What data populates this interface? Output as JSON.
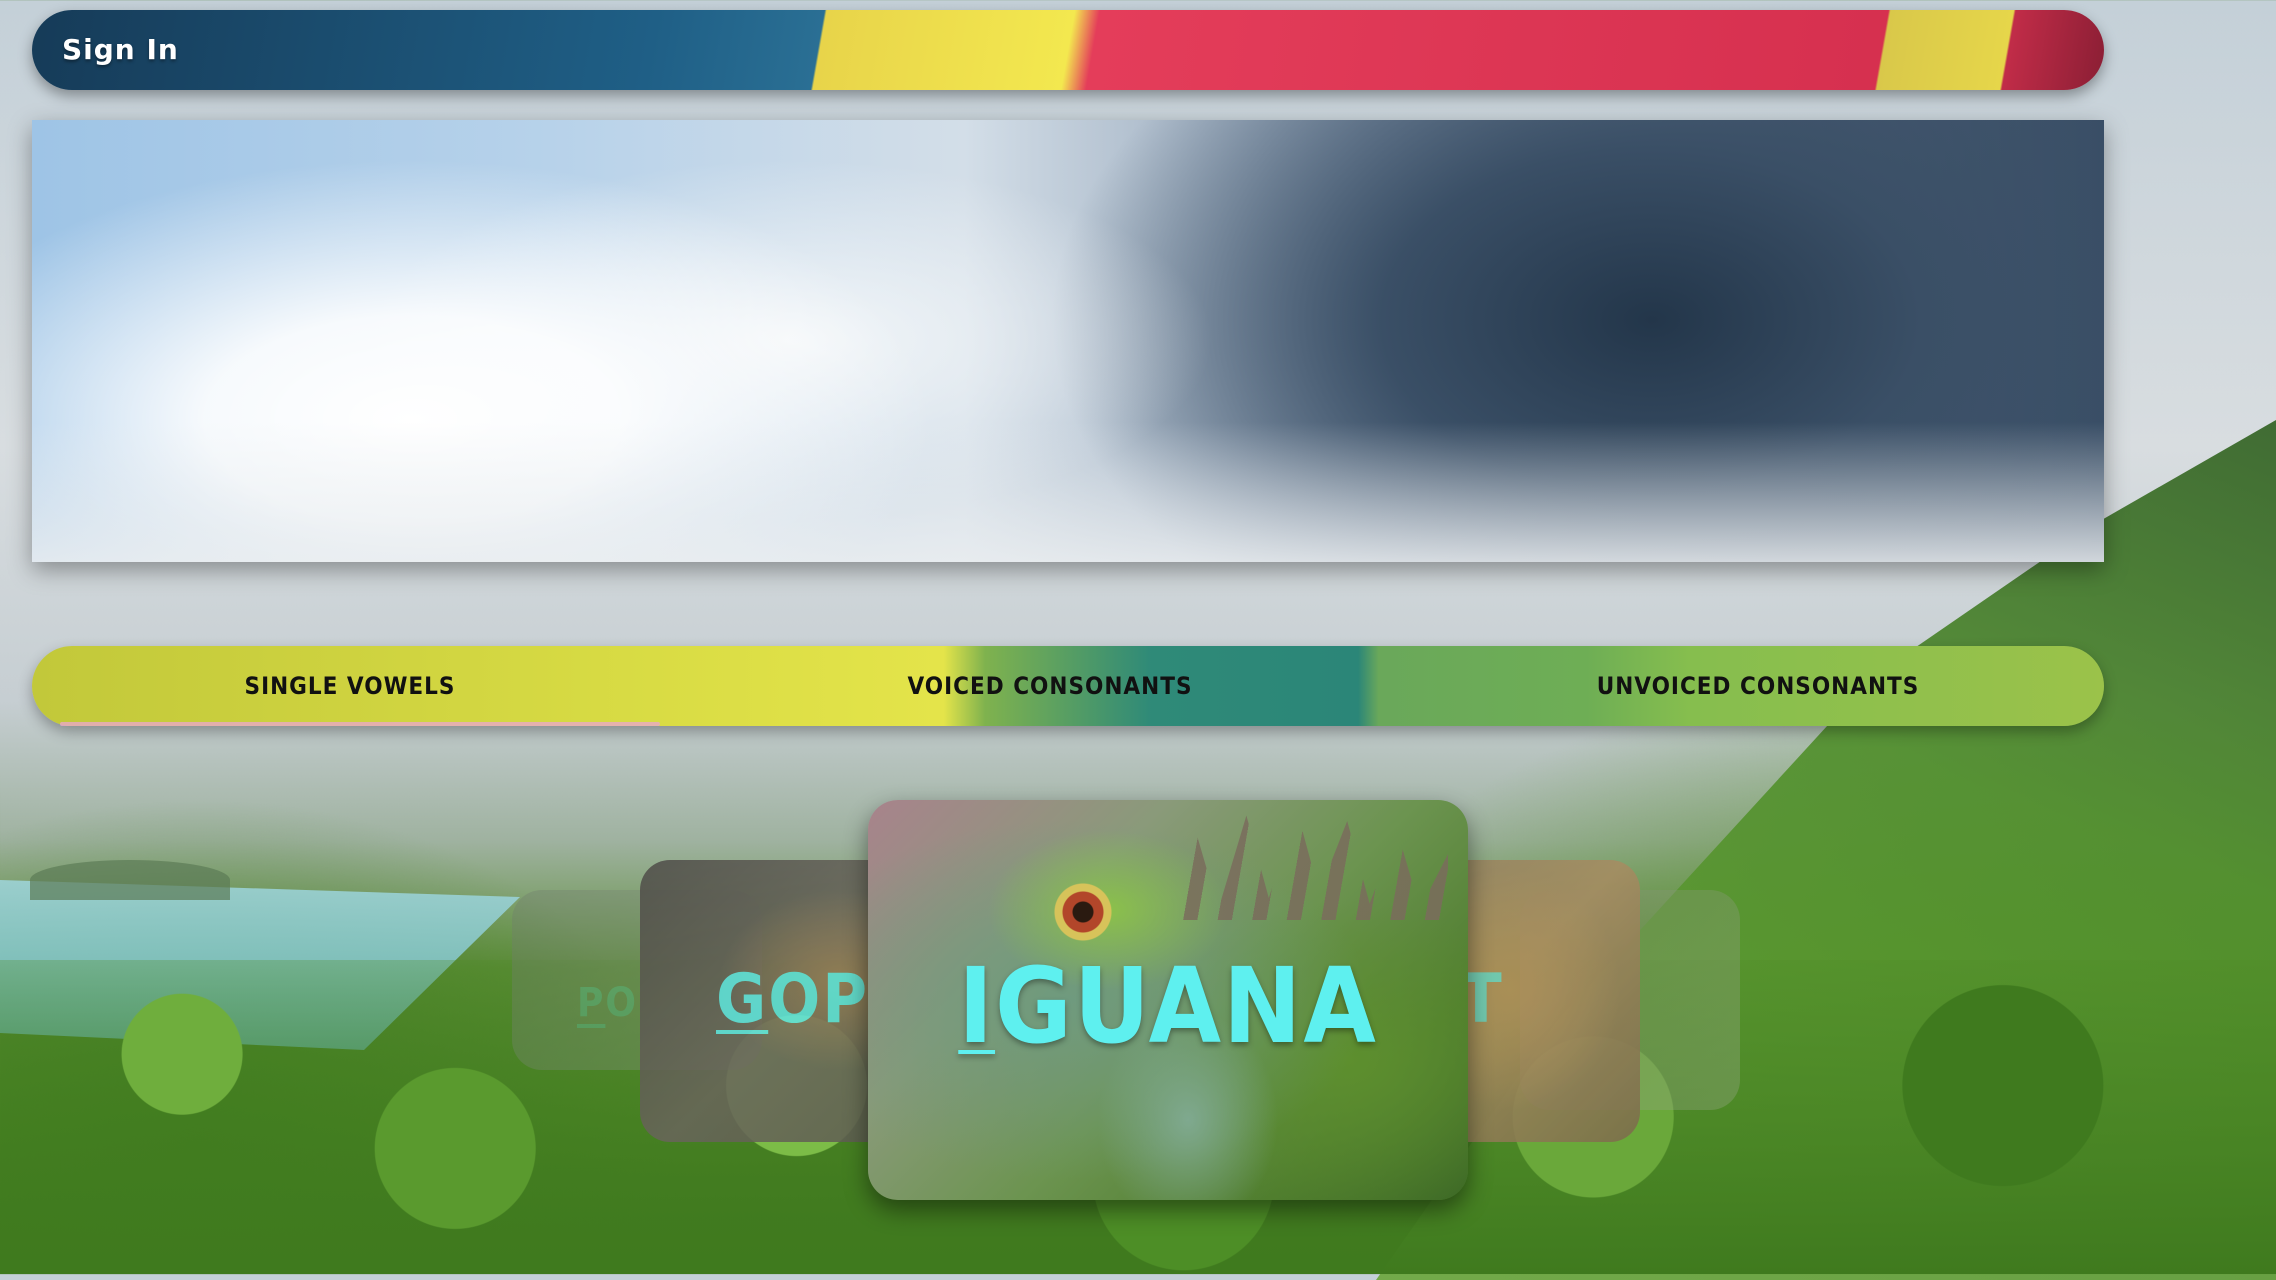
{
  "nav": {
    "sign_in_label": "Sign In"
  },
  "categories": {
    "tabs": [
      {
        "label": "Single Vowels"
      },
      {
        "label": "Voiced Consonants"
      },
      {
        "label": "Unvoiced Consonants"
      }
    ]
  },
  "carousel": {
    "far_left_word": {
      "first": "P",
      "rest": "O"
    },
    "left_word": {
      "first": "G",
      "rest": "OPH"
    },
    "center_word": {
      "first": "I",
      "rest": "GUANA"
    },
    "right_word": {
      "first": "",
      "rest": "T"
    },
    "word_color": "#5ef0ef"
  }
}
